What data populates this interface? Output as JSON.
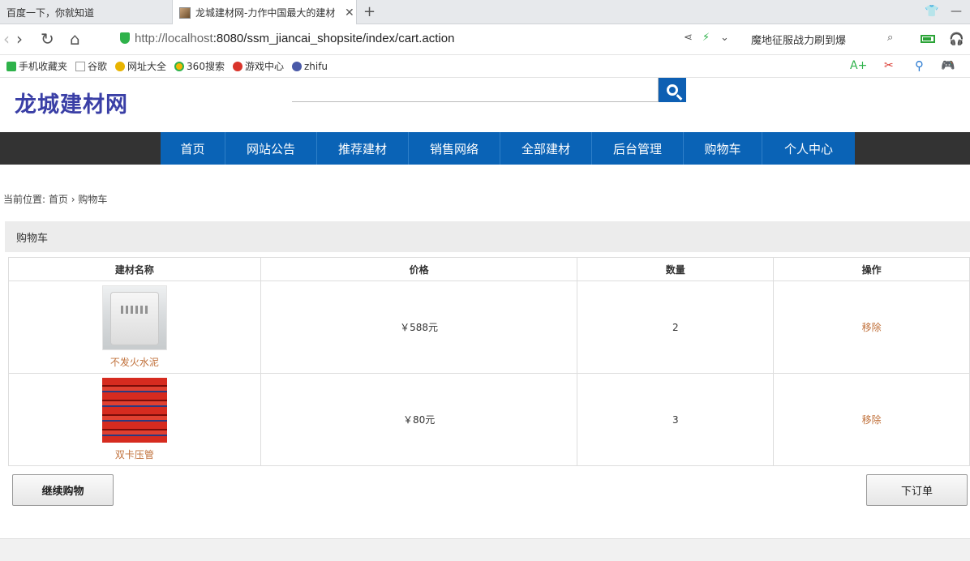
{
  "browser": {
    "tabs": [
      {
        "title": "百度一下，你就知道"
      },
      {
        "title": "龙城建材网-力作中国最大的建材"
      }
    ],
    "url_host": "http://localhost",
    "url_rest": ":8080/ssm_jiancai_shopsite/index/cart.action",
    "search_text": "魔地征服战力刷到爆",
    "bookmarks": [
      "手机收藏夹",
      "谷歌",
      "网址大全",
      "360搜索",
      "游戏中心",
      "zhifu"
    ]
  },
  "site": {
    "logo": "龙城建材网",
    "nav": [
      "首页",
      "网站公告",
      "推荐建材",
      "销售网络",
      "全部建材",
      "后台管理",
      "购物车",
      "个人中心"
    ]
  },
  "breadcrumb": {
    "prefix": "当前位置:",
    "home": "首页",
    "sep": "›",
    "current": "购物车"
  },
  "cart": {
    "title": "购物车",
    "headers": [
      "建材名称",
      "价格",
      "数量",
      "操作"
    ],
    "items": [
      {
        "name": "不发火水泥",
        "price": "￥588元",
        "qty": "2",
        "action": "移除"
      },
      {
        "name": "双卡压管",
        "price": "￥80元",
        "qty": "3",
        "action": "移除"
      }
    ],
    "continue_label": "继续购物",
    "order_label": "下订单"
  },
  "colors": {
    "nav_blue": "#0a63b6",
    "nav_dark": "#333333",
    "logo": "#3a3fa6",
    "link_orange": "#c0703a"
  }
}
